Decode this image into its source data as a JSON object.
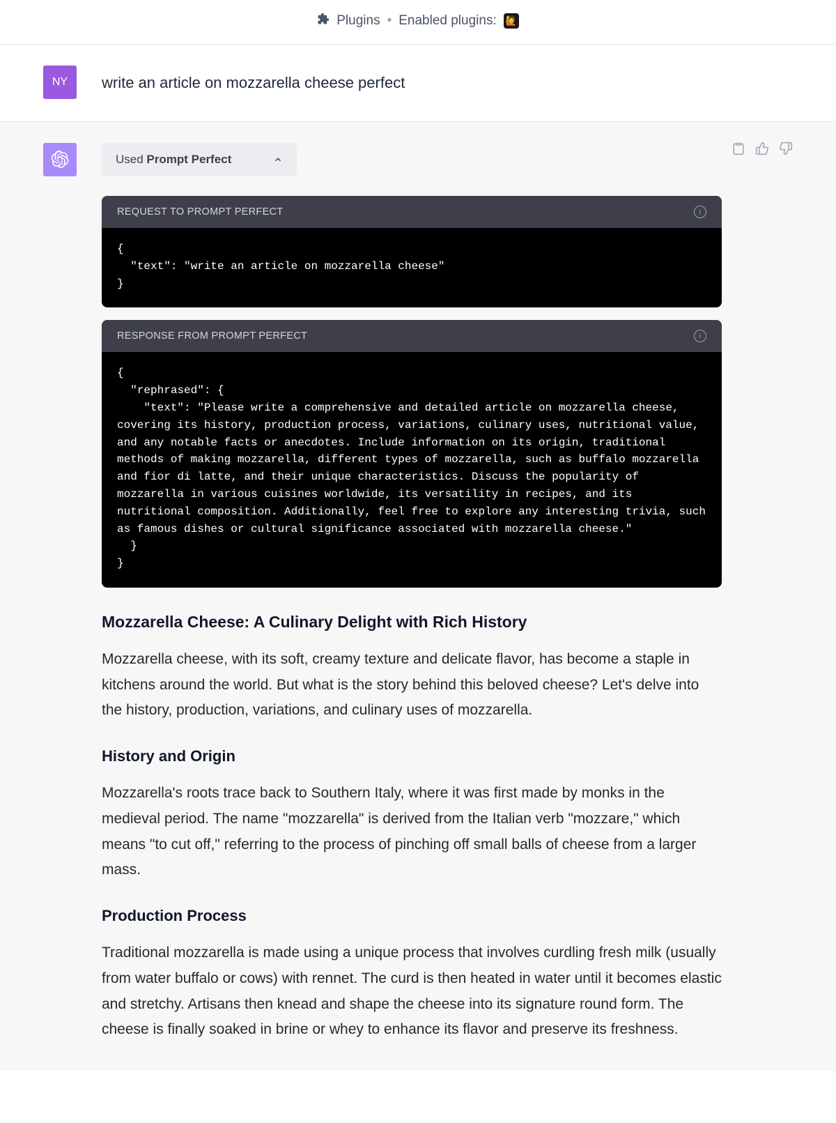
{
  "topbar": {
    "plugins_label": "Plugins",
    "enabled_label": "Enabled plugins:",
    "plugin_emoji": "🙋"
  },
  "user": {
    "avatar_text": "NY",
    "prompt": "write an article on mozzarella cheese perfect"
  },
  "plugin_chip": {
    "prefix": "Used ",
    "name": "Prompt Perfect"
  },
  "request_block": {
    "header": "REQUEST TO PROMPT PERFECT",
    "body": "{\n  \"text\": \"write an article on mozzarella cheese\"\n}"
  },
  "response_block": {
    "header": "RESPONSE FROM PROMPT PERFECT",
    "body": "{\n  \"rephrased\": {\n    \"text\": \"Please write a comprehensive and detailed article on mozzarella cheese, covering its history, production process, variations, culinary uses, nutritional value, and any notable facts or anecdotes. Include information on its origin, traditional methods of making mozzarella, different types of mozzarella, such as buffalo mozzarella and fior di latte, and their unique characteristics. Discuss the popularity of mozzarella in various cuisines worldwide, its versatility in recipes, and its nutritional composition. Additionally, feel free to explore any interesting trivia, such as famous dishes or cultural significance associated with mozzarella cheese.\"\n  }\n}"
  },
  "article": {
    "title": "Mozzarella Cheese: A Culinary Delight with Rich History",
    "intro": "Mozzarella cheese, with its soft, creamy texture and delicate flavor, has become a staple in kitchens around the world. But what is the story behind this beloved cheese? Let's delve into the history, production, variations, and culinary uses of mozzarella.",
    "h_history": "History and Origin",
    "p_history": "Mozzarella's roots trace back to Southern Italy, where it was first made by monks in the medieval period. The name \"mozzarella\" is derived from the Italian verb \"mozzare,\" which means \"to cut off,\" referring to the process of pinching off small balls of cheese from a larger mass.",
    "h_production": "Production Process",
    "p_production": "Traditional mozzarella is made using a unique process that involves curdling fresh milk (usually from water buffalo or cows) with rennet. The curd is then heated in water until it becomes elastic and stretchy. Artisans then knead and shape the cheese into its signature round form. The cheese is finally soaked in brine or whey to enhance its flavor and preserve its freshness."
  }
}
